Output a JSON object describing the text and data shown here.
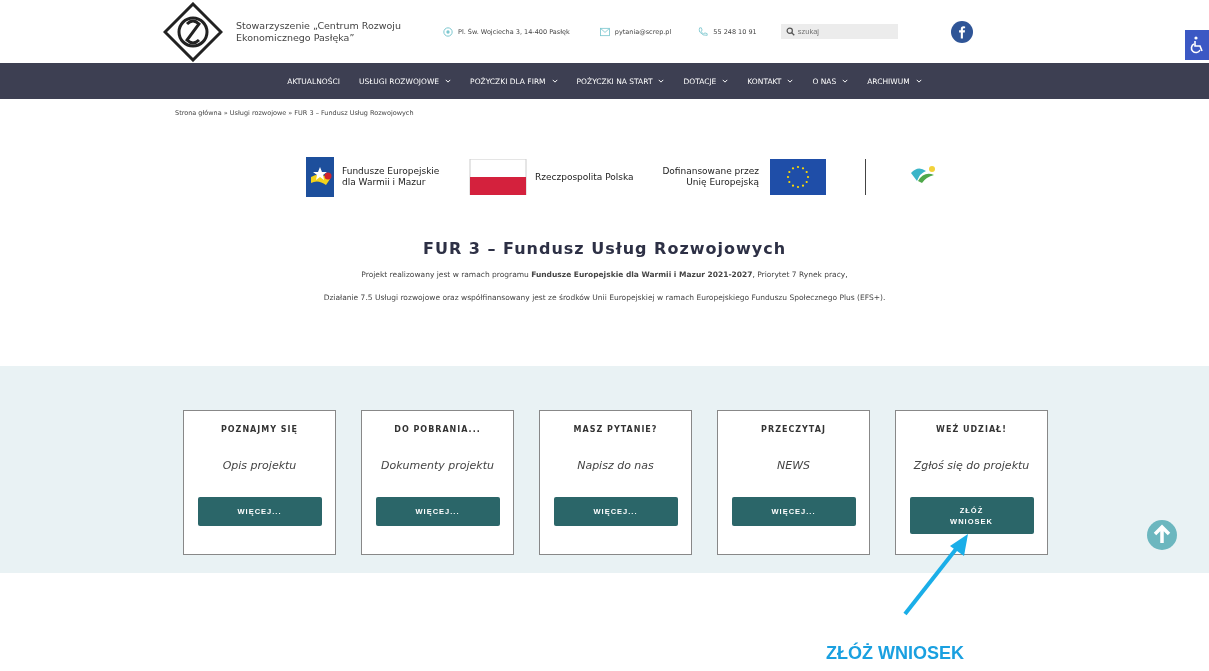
{
  "header": {
    "org_name": "Stowarzyszenie „Centrum Rozwoju Ekonomicznego Pasłęka”",
    "address": "Pl. Św. Wojciecha 3, 14-400 Pasłęk",
    "email": "pytania@screp.pl",
    "phone": "55 248 10 91",
    "search": {
      "placeholder": "szukaj"
    }
  },
  "nav": [
    {
      "label": "AKTUALNOŚCI",
      "dropdown": false
    },
    {
      "label": "USŁUGI ROZWOJOWE",
      "dropdown": true
    },
    {
      "label": "POŻYCZKI DLA FIRM",
      "dropdown": true
    },
    {
      "label": "POŻYCZKI NA START",
      "dropdown": true
    },
    {
      "label": "DOTACJE",
      "dropdown": true
    },
    {
      "label": "KONTAKT",
      "dropdown": true
    },
    {
      "label": "O NAS",
      "dropdown": true
    },
    {
      "label": "ARCHIWUM",
      "dropdown": true
    }
  ],
  "breadcrumb": "Strona główna » Usługi rozwojowe » FUR 3 – Fundusz Usług Rozwojowych",
  "funding_logos": {
    "fe": "Fundusze Europejskie dla Warmii i Mazur",
    "rp": "Rzeczpospolita Polska",
    "eu": "Dofinansowane przez Unię Europejską"
  },
  "title": "FUR 3 – Fundusz Usług Rozwojowych",
  "paragraphs": [
    "Projekt realizowany jest w ramach programu **Fundusze Europejskie dla Warmii i Mazur 2021-2027**, Priorytet 7 Rynek pracy,",
    "Działanie 7.5 Usługi rozwojowe oraz współfinansowany jest ze środków Unii Europejskiej w ramach Europejskiego Funduszu Społecznego Plus (EFS+)."
  ],
  "cards": [
    {
      "heading": "POZNAJMY SIĘ",
      "text": "Opis projektu",
      "button": "WIĘCEJ..."
    },
    {
      "heading": "DO POBRANIA...",
      "text": "Dokumenty projektu",
      "button": "WIĘCEJ..."
    },
    {
      "heading": "MASZ PYTANIE?",
      "text": "Napisz do nas",
      "button": "WIĘCEJ..."
    },
    {
      "heading": "PRZECZYTAJ",
      "text": "NEWS",
      "button": "WIĘCEJ..."
    },
    {
      "heading": "WEŹ UDZIAŁ!",
      "text": "Zgłoś się do projektu",
      "button": "ZŁÓŻ WNIOSEK"
    }
  ],
  "annotation": "ZŁÓŻ WNIOSEK"
}
